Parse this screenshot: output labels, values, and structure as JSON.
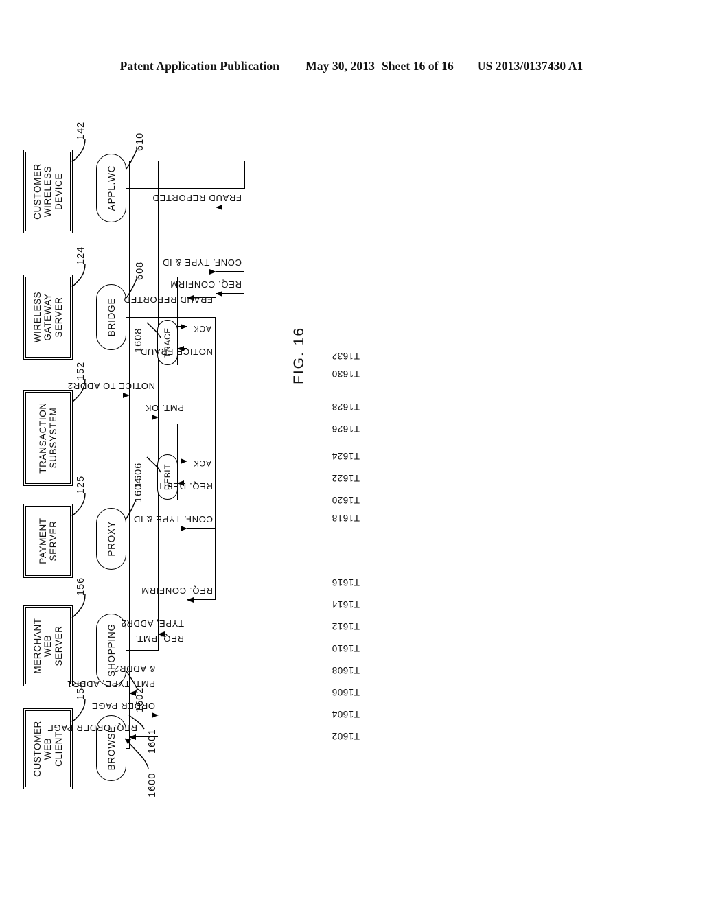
{
  "header": {
    "publication": "Patent Application Publication",
    "date": "May 30, 2013",
    "sheet": "Sheet 16 of 16",
    "number": "US 2013/0137430 A1"
  },
  "figure": {
    "label": "FIG. 16",
    "diagram_ref": "1600",
    "lifeline_group_ref": "1601"
  },
  "actors": [
    {
      "id": "customer-web-client",
      "name": "CUSTOMER WEB CLIENT",
      "lines": [
        "CUSTOMER",
        "WEB",
        "CLIENT"
      ],
      "ref": "154"
    },
    {
      "id": "merchant-web-server",
      "name": "MERCHANT WEB SERVER",
      "lines": [
        "MERCHANT",
        "WEB",
        "SERVER"
      ],
      "ref": "156"
    },
    {
      "id": "payment-server",
      "name": "PAYMENT SERVER",
      "lines": [
        "PAYMENT",
        "SERVER"
      ],
      "ref": "125"
    },
    {
      "id": "transaction-subsystem",
      "name": "TRANSACTION SUBSYSTEM",
      "lines": [
        "TRANSACTION",
        "SUBSYSTEM"
      ],
      "ref": "152"
    },
    {
      "id": "wireless-gateway-server",
      "name": "WIRELESS GATEWAY SERVER",
      "lines": [
        "WIRELESS",
        "GATEWAY",
        "SERVER"
      ],
      "ref": "124"
    },
    {
      "id": "customer-wireless-device",
      "name": "CUSTOMER WIRELESS DEVICE",
      "lines": [
        "CUSTOMER",
        "WIRELESS",
        "DEVICE"
      ],
      "ref": "142"
    }
  ],
  "lifelines": [
    {
      "id": "browse",
      "label": "BROWSE",
      "ref": ""
    },
    {
      "id": "shopping",
      "label": "SHOPPING",
      "ref": "1602"
    },
    {
      "id": "proxy",
      "label": "PROXY",
      "ref": "1604"
    },
    {
      "id": "bridge",
      "label": "BRIDGE",
      "ref": "608"
    },
    {
      "id": "appl-wc",
      "label": "APPL.WC",
      "ref": "610"
    }
  ],
  "activities": [
    {
      "id": "debit",
      "label": "DEBIT",
      "ref": "1606"
    },
    {
      "id": "trace",
      "label": "TRACE",
      "ref": "1608"
    }
  ],
  "time_markers": [
    "T1602",
    "T1604",
    "T1606",
    "T1608",
    "T1610",
    "T1612",
    "T1614",
    "T1616",
    "T1618",
    "T1620",
    "T1622",
    "T1624",
    "T1626",
    "T1628",
    "T1630",
    "T1632"
  ],
  "messages": [
    {
      "id": "m1",
      "time": "T1602",
      "from": "browse",
      "to": "shopping",
      "label": "REQ. ORDER PAGE"
    },
    {
      "id": "m2",
      "time": "T1604",
      "from": "shopping",
      "to": "browse",
      "label": "ORDER PAGE"
    },
    {
      "id": "m3",
      "time": "T1606",
      "from": "browse",
      "to": "shopping",
      "label": "PMT. TYPE, ADDR1 & ADDR2",
      "lines": [
        "PMT. TYPE, ADDR1",
        "& ADDR2"
      ]
    },
    {
      "id": "m4",
      "time": "T1608",
      "from": "shopping",
      "to": "proxy",
      "label": "REQ. PMT. TYPE, ADDR2",
      "lines": [
        "REQ. PMT.",
        "TYPE, ADDR2"
      ]
    },
    {
      "id": "m5",
      "time": "T1610",
      "from": "proxy",
      "to": "bridge",
      "label": "REQ. CONFIRM"
    },
    {
      "id": "m6",
      "time": "T1612",
      "from": "bridge",
      "to": "appl-wc",
      "label": "REQ. CONFIRM"
    },
    {
      "id": "m7",
      "time": "T1614",
      "from": "appl-wc",
      "to": "bridge",
      "label": "CONF. TYPE & ID"
    },
    {
      "id": "m8",
      "time": "T1616",
      "from": "bridge",
      "to": "proxy",
      "label": "CONF. TYPE & ID"
    },
    {
      "id": "m9",
      "time": "T1618",
      "from": "proxy",
      "to": "debit",
      "label": "REQ. DEBIT"
    },
    {
      "id": "m10",
      "time": "T1620",
      "from": "debit",
      "to": "proxy",
      "label": "ACK"
    },
    {
      "id": "m11",
      "time": "T1622",
      "from": "proxy",
      "to": "shopping",
      "label": "PMT. OK"
    },
    {
      "id": "m12",
      "time": "T1624",
      "from": "shopping",
      "to": "browse",
      "label": "NOTICE TO ADDR2"
    },
    {
      "id": "m13",
      "time": "T1626",
      "from": "proxy",
      "to": "trace",
      "label": "NOTICE FRAUD"
    },
    {
      "id": "m14",
      "time": "T1628",
      "from": "trace",
      "to": "proxy",
      "label": "ACK"
    },
    {
      "id": "m15",
      "time": "T1630",
      "from": "proxy",
      "to": "bridge",
      "label": "FRAUD REPORTED"
    },
    {
      "id": "m16",
      "time": "T1632",
      "from": "bridge",
      "to": "appl-wc",
      "label": "FRAUD REPORTED"
    }
  ]
}
